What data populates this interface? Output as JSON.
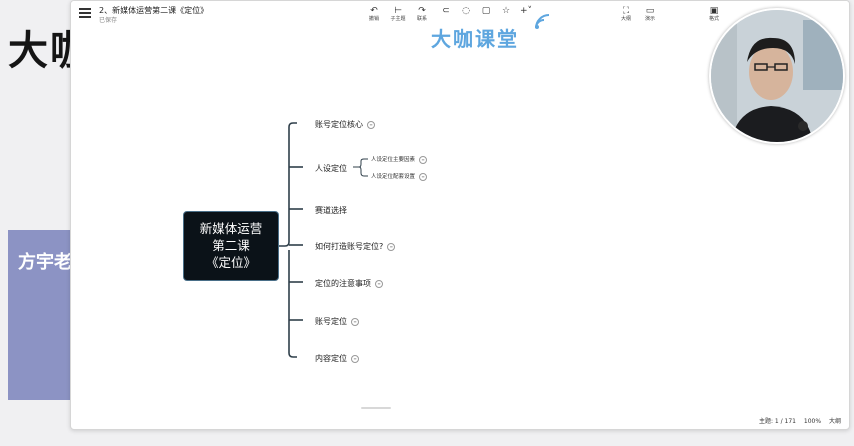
{
  "background": {
    "brand": "大咖",
    "panel_text": "方宇老"
  },
  "window": {
    "title": "2、新媒体运营第二课《定位》",
    "status": "已保存"
  },
  "toolbar": {
    "undo": "撤销",
    "subtopic": "子主题",
    "link": "联系",
    "outline": "大纲",
    "presentation": "演示",
    "style": "格式"
  },
  "watermark": "大咖课堂",
  "mindmap": {
    "root": {
      "line1": "新媒体运营",
      "line2": "第二课",
      "line3": "《定位》"
    },
    "branches": [
      {
        "label": "账号定位核心"
      },
      {
        "label": "人设定位",
        "children": [
          "人设定位主要因素",
          "人设定位配套设置"
        ]
      },
      {
        "label": "赛道选择"
      },
      {
        "label": "如何打造账号定位?"
      },
      {
        "label": "定位的注意事项"
      },
      {
        "label": "账号定位"
      },
      {
        "label": "内容定位"
      }
    ]
  },
  "status_bar": {
    "topics": "主题: 1 / 171",
    "zoom": "100%",
    "size": "大纲"
  },
  "colors": {
    "root_bg": "#0b1218",
    "connector": "#2f3f4a",
    "watermark": "#5ea6df",
    "panel": "#8c93c4"
  }
}
